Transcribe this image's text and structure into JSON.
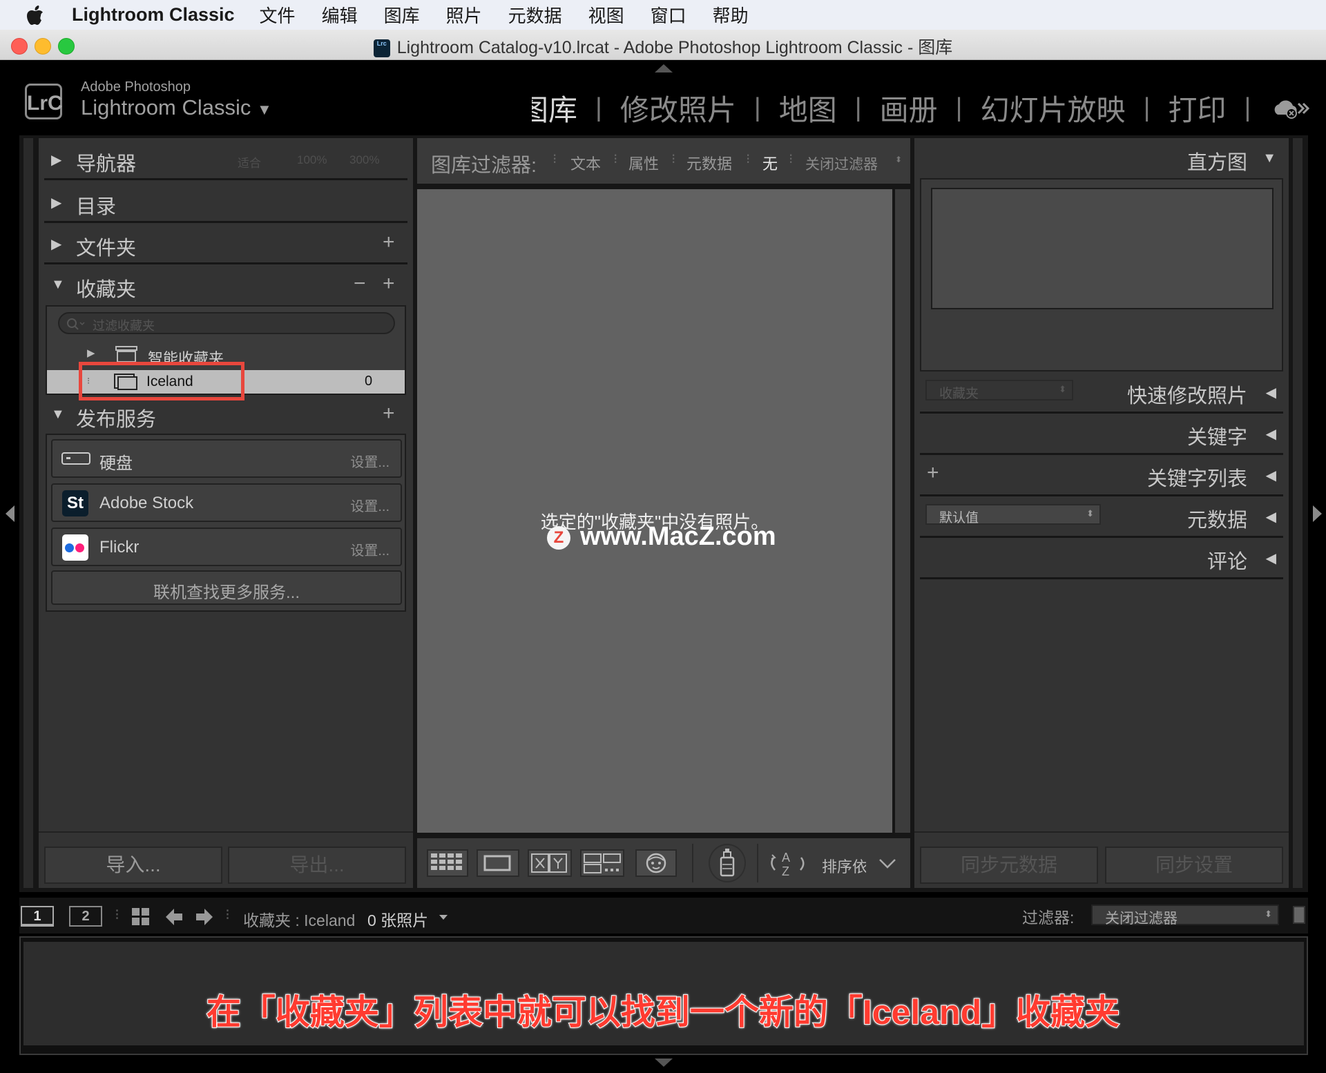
{
  "menubar": {
    "app_name": "Lightroom Classic",
    "items": [
      "文件",
      "编辑",
      "图库",
      "照片",
      "元数据",
      "视图",
      "窗口",
      "帮助"
    ]
  },
  "window": {
    "title": "Lightroom Catalog-v10.lrcat - Adobe Photoshop Lightroom Classic - 图库",
    "icon_text": "Lrc"
  },
  "header": {
    "logo": "LrC",
    "brand_line1": "Adobe Photoshop",
    "brand_line2": "Lightroom Classic",
    "modules": [
      "图库",
      "修改照片",
      "地图",
      "画册",
      "幻灯片放映",
      "打印"
    ],
    "visible_modules": [
      "图库",
      "修改照片",
      "地图",
      "画册",
      "幻灯片放映",
      "打印"
    ],
    "active_module_label": "图库"
  },
  "left_panel": {
    "navigator": {
      "label": "导航器",
      "zoom": [
        "适合",
        "100%",
        "300%"
      ]
    },
    "catalog": {
      "label": "目录"
    },
    "folders": {
      "label": "文件夹"
    },
    "collections": {
      "label": "收藏夹",
      "filter_placeholder": "过滤收藏夹",
      "items": [
        {
          "label": "智能收藏夹",
          "count": ""
        },
        {
          "label": "Iceland",
          "count": "0"
        }
      ]
    },
    "publish": {
      "label": "发布服务",
      "services": [
        {
          "name": "硬盘",
          "settings": "设置..."
        },
        {
          "name": "Adobe Stock",
          "settings": "设置..."
        },
        {
          "name": "Flickr",
          "settings": "设置..."
        }
      ],
      "find_more": "联机查找更多服务..."
    },
    "import_btn": "导入...",
    "export_btn": "导出..."
  },
  "center": {
    "filter_bar": {
      "label": "图库过滤器:",
      "options": [
        "文本",
        "属性",
        "元数据",
        "无"
      ],
      "preset": "关闭过滤器"
    },
    "empty_message": "选定的\"收藏夹\"中没有照片。",
    "watermark": "www.MacZ.com",
    "sort_label": "排序依据"
  },
  "right_panel": {
    "histogram": "直方图",
    "quick_develop": "快速修改照片",
    "quick_develop_select": "收藏夹",
    "keywording": "关键字",
    "keyword_list": "关键字列表",
    "metadata": "元数据",
    "metadata_select": "默认值",
    "comments": "评论",
    "sync_metadata": "同步元数据",
    "sync_settings": "同步设置"
  },
  "filmstrip": {
    "page1": "1",
    "page2": "2",
    "source": "收藏夹 : Iceland",
    "photo_count": "0 张照片",
    "filter_label": "过滤器:",
    "filter_value": "关闭过滤器"
  },
  "caption": "在「收藏夹」列表中就可以找到一个新的「Iceland」收藏夹",
  "colors": {
    "highlight_box": "#e8473d",
    "caption_text": "#ff3b30",
    "panel_bg": "#333333",
    "center_bg": "#626262"
  }
}
